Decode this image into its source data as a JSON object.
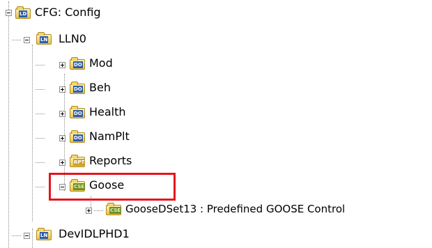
{
  "tree": {
    "root": {
      "tag": "LD",
      "label": "CFG: Config",
      "expanded": true
    },
    "lln0": {
      "tag": "LN",
      "label": "LLN0",
      "expanded": true
    },
    "mod": {
      "tag": "DO",
      "label": "Mod",
      "expanded": false
    },
    "beh": {
      "tag": "DO",
      "label": "Beh",
      "expanded": false
    },
    "health": {
      "tag": "DO",
      "label": "Health",
      "expanded": false
    },
    "namplt": {
      "tag": "DO",
      "label": "NamPlt",
      "expanded": false
    },
    "reports": {
      "tag": "RPT",
      "label": "Reports",
      "expanded": false
    },
    "goose": {
      "tag": "CSE",
      "label": "Goose",
      "expanded": true,
      "highlighted": true
    },
    "goosedset13": {
      "tag": "CSE",
      "label": "GooseDSet13 : Predefined GOOSE Control",
      "expanded": false
    },
    "devidlphd1": {
      "tag": "LN",
      "label": "DevIDLPHD1",
      "expanded": true
    }
  },
  "colors": {
    "highlight": "#e4151c",
    "folder": "#e9c24a",
    "tag_ld_ln_do": "#2f5ea8",
    "tag_cse": "#6a8e2a"
  }
}
